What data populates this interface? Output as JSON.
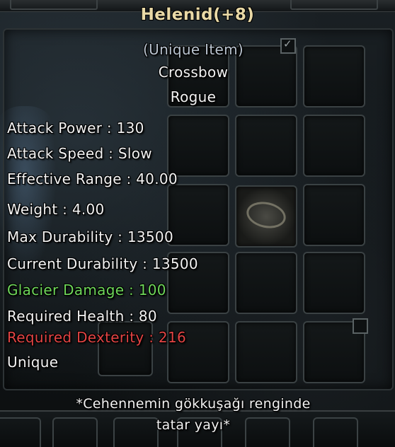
{
  "item": {
    "title": "Helenid(+8)",
    "rarity": "(Unique Item)",
    "type": "Crossbow",
    "class": "Rogue",
    "stats": {
      "attack_power": "Attack Power : 130",
      "attack_speed": "Attack Speed : Slow",
      "effective_range": "Effective Range : 40.00",
      "weight": "Weight : 4.00",
      "max_durability": "Max Durability : 13500",
      "current_durability": "Current Durability : 13500",
      "glacier_damage": "Glacier Damage : 100",
      "required_health": "Required Health : 80",
      "required_dexterity": "Required Dexterity : 216"
    },
    "tag": "Unique",
    "description_line1": "*Cehennemin gökkuşağı renginde",
    "description_line2": "tatar yayı*"
  },
  "colors": {
    "title": "#e9d9a6",
    "rarity": "#b9c3cf",
    "normal": "#f2f2f2",
    "bonus": "#6ed65a",
    "requirement_unmet": "#e24444"
  },
  "icons": [
    "checkbox-icon",
    "bracelet-item-icon",
    "horn-item-icon"
  ]
}
